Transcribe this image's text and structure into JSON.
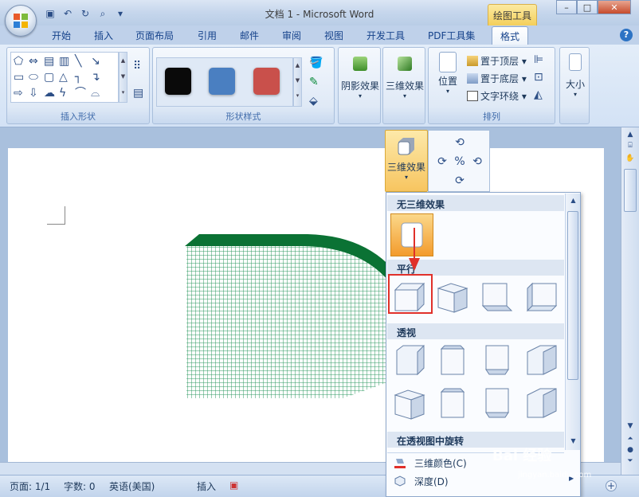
{
  "window": {
    "title": "文档 1 - Microsoft Word",
    "contextual_tool_title": "绘图工具",
    "controls": [
      "minimize",
      "maximize",
      "close"
    ]
  },
  "tabs": [
    {
      "label": "开始"
    },
    {
      "label": "插入"
    },
    {
      "label": "页面布局"
    },
    {
      "label": "引用"
    },
    {
      "label": "邮件"
    },
    {
      "label": "审阅"
    },
    {
      "label": "视图"
    },
    {
      "label": "开发工具"
    },
    {
      "label": "PDF工具集"
    },
    {
      "label": "格式",
      "active": true
    }
  ],
  "ribbon": {
    "groups": {
      "insert_shapes": "插入形状",
      "shape_styles": "形状样式",
      "arrange": "排列"
    },
    "shape_style_colors": [
      "#0a0a0a",
      "#4a7fc1",
      "#c9504b"
    ],
    "shadow_effects": "阴影效果",
    "threed_effects": "三维效果",
    "position": "位置",
    "bring_to_front": "置于顶层",
    "send_to_back": "置于底层",
    "text_wrap": "文字环绕",
    "size": "大小"
  },
  "dropdown": {
    "button_label": "三维效果",
    "sections": {
      "none": "无三维效果",
      "parallel": "平行",
      "perspective": "透视",
      "rotate_in_perspective": "在透视图中旋转"
    },
    "items": {
      "color": "三维颜色(C)",
      "depth": "深度(D)"
    }
  },
  "document": {
    "shape_fill_pattern": "grid",
    "shape_colors": {
      "band": "#0b7234",
      "grid": "#2e9a60"
    }
  },
  "status": {
    "page": "页面: 1/1",
    "words": "字数: 0",
    "language": "英语(美国)",
    "mode": "插入"
  },
  "watermark": {
    "brand": "Bai 经验",
    "url": "jingyan.baidu.com"
  }
}
